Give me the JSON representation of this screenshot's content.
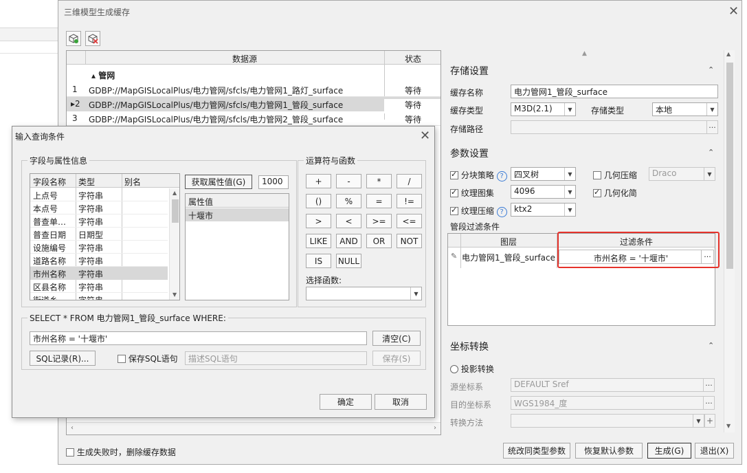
{
  "main": {
    "title": "三维模型生成缓存",
    "grid": {
      "col_source": "数据源",
      "col_status": "状态",
      "group": "管网",
      "rows": [
        {
          "idx": "1",
          "source": "GDBP://MapGISLocalPlus/电力管网/sfcls/电力管网1_路灯_surface",
          "status": "等待"
        },
        {
          "idx": "2",
          "source": "GDBP://MapGISLocalPlus/电力管网/sfcls/电力管网1_管段_surface",
          "status": "等待"
        },
        {
          "idx": "3",
          "source": "GDBP://MapGISLocalPlus/电力管网/sfcls/电力管网2_管段_surface",
          "status": "等待"
        }
      ]
    },
    "storage": {
      "title": "存储设置",
      "name_label": "缓存名称",
      "name_value": "电力管网1_管段_surface",
      "type_label": "缓存类型",
      "type_value": "M3D(2.1)",
      "store_label": "存储类型",
      "store_value": "本地",
      "path_label": "存储路径",
      "path_value": ""
    },
    "params": {
      "title": "参数设置",
      "block_label": "分块策略",
      "block_value": "四叉树",
      "geo_compress_label": "几何压缩",
      "geo_compress_value": "Draco",
      "atlas_label": "纹理图集",
      "atlas_value": "4096",
      "simplify_label": "几何化简",
      "tex_compress_label": "纹理压缩",
      "tex_compress_value": "ktx2",
      "filter_title": "管段过滤条件",
      "filter_col_layer": "图层",
      "filter_col_cond": "过滤条件",
      "filter_layer": "电力管网1_管段_surface",
      "filter_cond": "市州名称 = '十堰市'"
    },
    "coord": {
      "title": "坐标转换",
      "proj_label": "投影转换",
      "src_label": "源坐标系",
      "src_value": "DEFAULT Sref",
      "dst_label": "目的坐标系",
      "dst_value": "WGS1984_度",
      "method_label": "转换方法",
      "method_value": ""
    },
    "footer": {
      "delete_on_fail": "生成失败时，删除缓存数据",
      "unify_btn": "统改同类型参数",
      "restore_btn": "恢复默认参数",
      "generate_btn": "生成(G)",
      "exit_btn": "退出(X)"
    }
  },
  "dialog": {
    "title": "输入查询条件",
    "fields_group": "字段与属性信息",
    "fields_headers": [
      "字段名称",
      "类型",
      "别名"
    ],
    "fields": [
      {
        "name": "上点号",
        "type": "字符串"
      },
      {
        "name": "本点号",
        "type": "字符串"
      },
      {
        "name": "普查单…",
        "type": "字符串"
      },
      {
        "name": "普查日期",
        "type": "日期型"
      },
      {
        "name": "设施编号",
        "type": "字符串"
      },
      {
        "name": "道路名称",
        "type": "字符串"
      },
      {
        "name": "市州名称",
        "type": "字符串"
      },
      {
        "name": "区县名称",
        "type": "字符串"
      },
      {
        "name": "街道乡…",
        "type": "字符串"
      }
    ],
    "get_values_btn": "获取属性值(G)",
    "max_count": "1000",
    "values_header": "属性值",
    "values": [
      "十堰市"
    ],
    "ops_group": "运算符与函数",
    "ops": [
      "+",
      "-",
      "*",
      "/",
      "()",
      "%",
      "=",
      "!=",
      ">",
      "<",
      ">=",
      "<=",
      "LIKE",
      "AND",
      "OR",
      "NOT",
      "IS",
      "NULL"
    ],
    "func_label": "选择函数:",
    "func_value": "",
    "sql_group": "SELECT * FROM 电力管网1_管段_surface WHERE:",
    "sql_value": "市州名称 = '十堰市'",
    "clear_btn": "清空(C)",
    "sql_record_btn": "SQL记录(R)...",
    "save_sql_label": "保存SQL语句",
    "desc_placeholder": "描述SQL语句",
    "save_btn": "保存(S)",
    "ok_btn": "确定",
    "cancel_btn": "取消"
  }
}
